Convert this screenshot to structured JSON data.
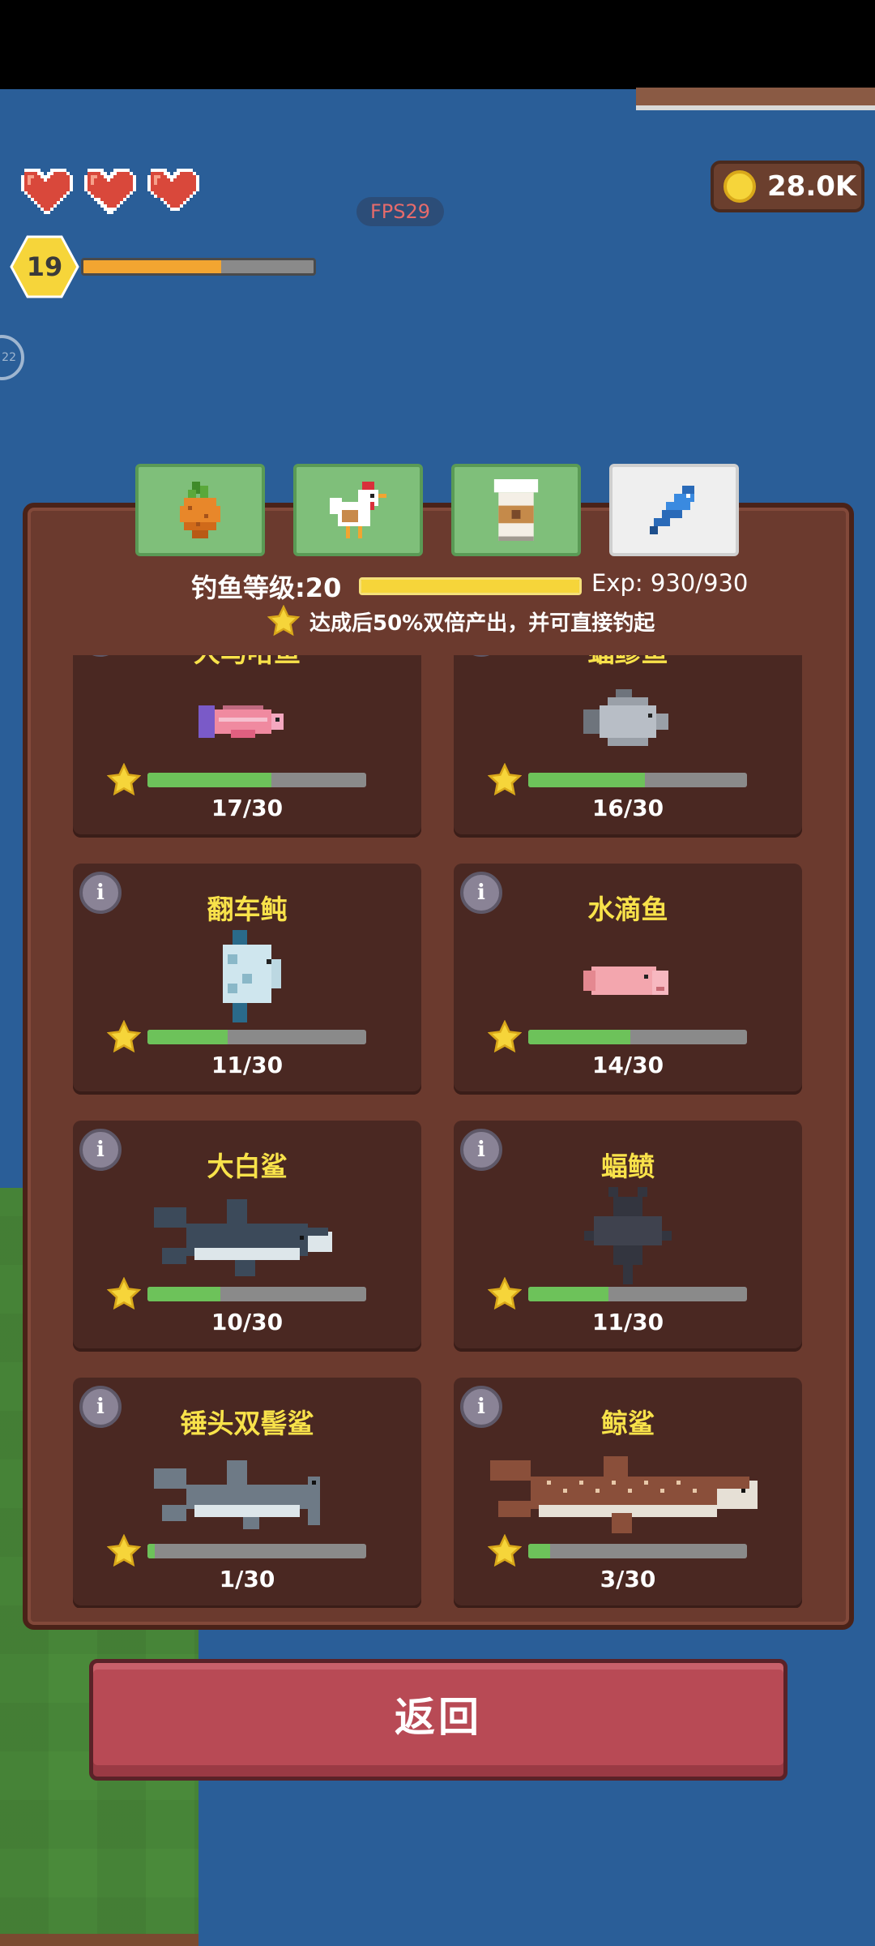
{
  "hud": {
    "fps": "FPS29",
    "coins": "28.0K",
    "player_level": "19",
    "xp_progress": 0.6,
    "hearts": 3,
    "side_button": "22"
  },
  "tabs": [
    {
      "name": "carrot-tab",
      "icon": "carrot-icon"
    },
    {
      "name": "chicken-tab",
      "icon": "chicken-icon"
    },
    {
      "name": "milk-tab",
      "icon": "milk-icon"
    },
    {
      "name": "fish-tab",
      "icon": "fish-icon",
      "active": true
    }
  ],
  "fishing": {
    "level_label": "钓鱼等级:20",
    "level_progress": 1.0,
    "exp_text": "Exp: 930/930",
    "bonus_text": "达成后50%双倍产出，并可直接钓起"
  },
  "cards": [
    {
      "name": "大马哈鱼",
      "count": "17/30",
      "progress": 0.5667,
      "fish": "salmon"
    },
    {
      "name": "蝠鲹鱼",
      "count": "16/30",
      "progress": 0.5333,
      "fish": "pomfret"
    },
    {
      "name": "翻车鲀",
      "count": "11/30",
      "progress": 0.3667,
      "fish": "sunfish"
    },
    {
      "name": "水滴鱼",
      "count": "14/30",
      "progress": 0.4667,
      "fish": "blobfish"
    },
    {
      "name": "大白鲨",
      "count": "10/30",
      "progress": 0.3333,
      "fish": "white-shark"
    },
    {
      "name": "蝠鲼",
      "count": "11/30",
      "progress": 0.3667,
      "fish": "manta-ray"
    },
    {
      "name": "锤头双髻鲨",
      "count": "1/30",
      "progress": 0.0333,
      "fish": "hammerhead"
    },
    {
      "name": "鲸鲨",
      "count": "3/30",
      "progress": 0.1,
      "fish": "whale-shark"
    }
  ],
  "back_label": "返回",
  "colors": {
    "water": "#2a5e98",
    "panel": "#6b3a2e",
    "card": "#4a2822",
    "accent_yellow": "#f8e24a",
    "progress_green": "#6dc25a",
    "back_button": "#b84a55"
  }
}
